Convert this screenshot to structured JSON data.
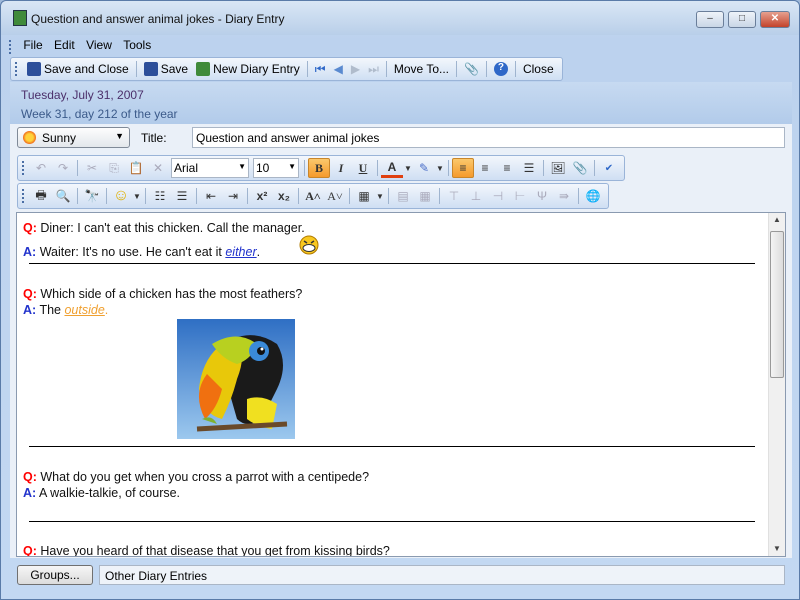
{
  "window": {
    "title": "Question and answer animal jokes - Diary Entry",
    "minimize": "–",
    "maximize": "□",
    "close": "✕"
  },
  "menu": [
    "File",
    "Edit",
    "View",
    "Tools"
  ],
  "toolbar": {
    "save_close": "Save and Close",
    "save": "Save",
    "new_entry": "New Diary Entry",
    "move_to": "Move To...",
    "close": "Close"
  },
  "date": {
    "line1": "Tuesday, July 31, 2007",
    "line2": "Week 31, day 212 of the year"
  },
  "weather": {
    "value": "Sunny"
  },
  "title_field": {
    "label": "Title:",
    "value": "Question and answer animal jokes"
  },
  "format": {
    "font": "Arial",
    "size": "10",
    "bold": "B",
    "italic": "I",
    "underline": "U",
    "superscript": "x²",
    "subscript": "x₂",
    "grow": "A˄",
    "shrink": "A˅"
  },
  "content": {
    "q_label": "Q:",
    "a_label": "A:",
    "j1q": "Diner: I can't eat this chicken. Call the manager.",
    "j1a": "Waiter: It's no use. He can't eat it",
    "j1a_link": "either",
    "j1a_end": ".",
    "j2q": "Which side of a chicken has the most feathers?",
    "j2a": "The ",
    "j2a_link": "outside",
    "j2a_end": ".",
    "j3q": "What do you get when you cross a parrot with a centipede?",
    "j3a": "A walkie-talkie, of course.",
    "j4q": "Have you heard of that disease that you get from kissing birds?"
  },
  "bottom": {
    "groups": "Groups...",
    "other": "Other Diary Entries"
  },
  "colors": {
    "question": "#ff0000",
    "answer": "#2233cc",
    "link_orange": "#f0a030"
  }
}
